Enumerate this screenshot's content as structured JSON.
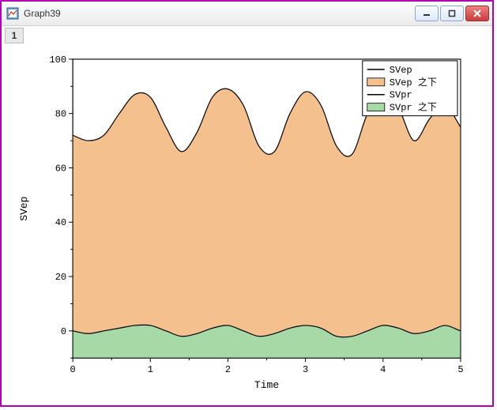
{
  "window": {
    "title": "Graph39"
  },
  "tab": {
    "label": "1"
  },
  "chart_data": {
    "type": "area",
    "title": "",
    "xlabel": "Time",
    "ylabel": "SVep",
    "xlim": [
      0,
      5
    ],
    "ylim": [
      -10,
      100
    ],
    "xticks": [
      0,
      1,
      2,
      3,
      4,
      5
    ],
    "yticks": [
      0,
      20,
      40,
      60,
      80,
      100
    ],
    "legend": {
      "position": "top-right",
      "items": [
        "SVep",
        "SVep 之下",
        "SVpr",
        "SVpr 之下"
      ]
    },
    "series": [
      {
        "name": "SVep",
        "fill_label": "SVep 之下",
        "color_line": "#000000",
        "color_fill": "#f4c08e",
        "x": [
          0.0,
          0.2,
          0.4,
          0.6,
          0.8,
          1.0,
          1.2,
          1.4,
          1.6,
          1.8,
          2.0,
          2.2,
          2.4,
          2.6,
          2.8,
          3.0,
          3.2,
          3.4,
          3.6,
          3.8,
          4.0,
          4.2,
          4.4,
          4.6,
          4.8,
          5.0,
          5.1
        ],
        "values": [
          72,
          70,
          72,
          80,
          87,
          86,
          75,
          66,
          73,
          86,
          89,
          83,
          68,
          66,
          80,
          88,
          83,
          68,
          65,
          80,
          88,
          82,
          70,
          78,
          83,
          75,
          71
        ]
      },
      {
        "name": "SVpr",
        "fill_label": "SVpr 之下",
        "color_line": "#000000",
        "color_fill": "#a6d9a6",
        "x": [
          0.0,
          0.2,
          0.4,
          0.6,
          0.8,
          1.0,
          1.2,
          1.4,
          1.6,
          1.8,
          2.0,
          2.2,
          2.4,
          2.6,
          2.8,
          3.0,
          3.2,
          3.4,
          3.6,
          3.8,
          4.0,
          4.2,
          4.4,
          4.6,
          4.8,
          5.0,
          5.1
        ],
        "values": [
          0,
          -1,
          0,
          1,
          2,
          2,
          0,
          -2,
          -1,
          1,
          2,
          0,
          -2,
          -1,
          1,
          2,
          1,
          -2,
          -2,
          0,
          2,
          1,
          -1,
          0,
          2,
          0,
          0
        ]
      }
    ]
  }
}
